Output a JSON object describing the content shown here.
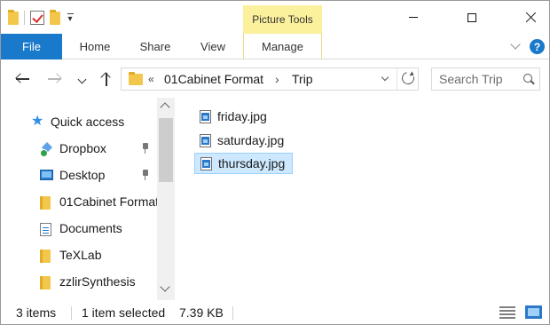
{
  "titlebar": {
    "contextual_tab": "Picture Tools"
  },
  "ribbon": {
    "tabs": [
      {
        "label": "File"
      },
      {
        "label": "Home"
      },
      {
        "label": "Share"
      },
      {
        "label": "View"
      },
      {
        "label": "Manage"
      }
    ],
    "help": "?"
  },
  "address": {
    "overflow": "«",
    "segments": [
      "01Cabinet Format",
      "Trip"
    ],
    "separator": "›"
  },
  "search": {
    "placeholder": "Search Trip"
  },
  "nav_pane": {
    "quick_access": "Quick access",
    "items": [
      {
        "label": "Dropbox",
        "icon": "dropbox-icon",
        "pinned": true
      },
      {
        "label": "Desktop",
        "icon": "desktop-icon",
        "pinned": true
      },
      {
        "label": "01Cabinet Format",
        "icon": "folder-icon",
        "pinned": false
      },
      {
        "label": "Documents",
        "icon": "documents-icon",
        "pinned": false
      },
      {
        "label": "TeXLab",
        "icon": "folder-icon",
        "pinned": false
      },
      {
        "label": "zzlirSynthesis",
        "icon": "folder-icon",
        "pinned": false
      }
    ]
  },
  "files": [
    {
      "name": "friday.jpg",
      "selected": false
    },
    {
      "name": "saturday.jpg",
      "selected": false
    },
    {
      "name": "thursday.jpg",
      "selected": true
    }
  ],
  "status": {
    "count": "3 items",
    "selected": "1 item selected",
    "size": "7.39 KB"
  },
  "colors": {
    "file_tab": "#1979ca",
    "picture_tools": "#fbf09c",
    "selection": "#cde8ff",
    "selection_border": "#99d1ff"
  }
}
